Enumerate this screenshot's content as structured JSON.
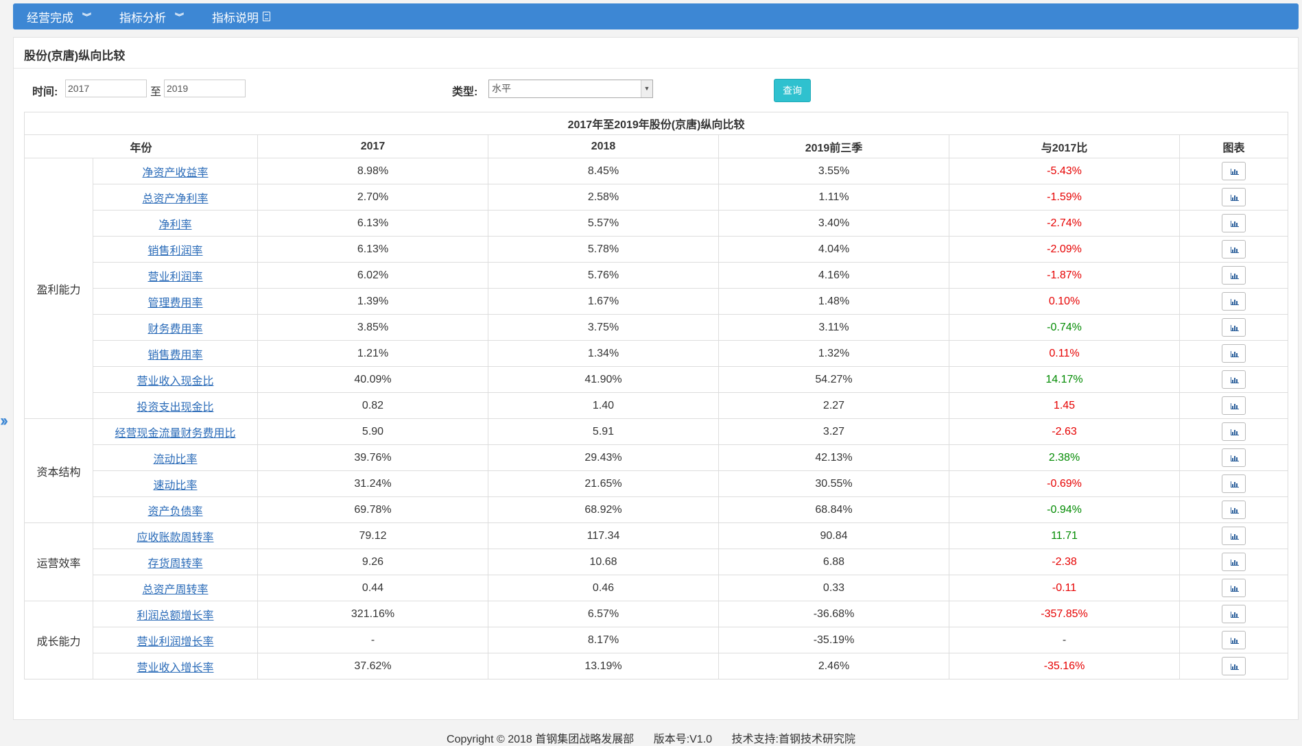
{
  "nav": [
    {
      "label": "经营完成",
      "icon": "double-chevron-down-icon"
    },
    {
      "label": "指标分析",
      "icon": "double-chevron-down-icon"
    },
    {
      "label": "指标说明",
      "icon": "document-icon"
    }
  ],
  "panel": {
    "title": "股份(京唐)纵向比较"
  },
  "filters": {
    "time_label": "时间:",
    "from_value": "2017",
    "to_text": "至",
    "to_value": "2019",
    "type_label": "类型:",
    "type_value": "水平",
    "query_label": "查询"
  },
  "table": {
    "caption": "2017年至2019年股份(京唐)纵向比较",
    "headers": [
      "年份",
      "2017",
      "2018",
      "2019前三季",
      "与2017比",
      "图表"
    ],
    "groups": [
      {
        "category": "盈利能力",
        "rows": [
          {
            "name": "净资产收益率",
            "v2017": "8.98%",
            "v2018": "8.45%",
            "v2019": "3.55%",
            "diff": "-5.43%",
            "trend": "neg"
          },
          {
            "name": "总资产净利率",
            "v2017": "2.70%",
            "v2018": "2.58%",
            "v2019": "1.11%",
            "diff": "-1.59%",
            "trend": "neg"
          },
          {
            "name": "净利率",
            "v2017": "6.13%",
            "v2018": "5.57%",
            "v2019": "3.40%",
            "diff": "-2.74%",
            "trend": "neg"
          },
          {
            "name": "销售利润率",
            "v2017": "6.13%",
            "v2018": "5.78%",
            "v2019": "4.04%",
            "diff": "-2.09%",
            "trend": "neg"
          },
          {
            "name": "营业利润率",
            "v2017": "6.02%",
            "v2018": "5.76%",
            "v2019": "4.16%",
            "diff": "-1.87%",
            "trend": "neg"
          },
          {
            "name": "管理费用率",
            "v2017": "1.39%",
            "v2018": "1.67%",
            "v2019": "1.48%",
            "diff": "0.10%",
            "trend": "neg"
          },
          {
            "name": "财务费用率",
            "v2017": "3.85%",
            "v2018": "3.75%",
            "v2019": "3.11%",
            "diff": "-0.74%",
            "trend": "pos"
          },
          {
            "name": "销售费用率",
            "v2017": "1.21%",
            "v2018": "1.34%",
            "v2019": "1.32%",
            "diff": "0.11%",
            "trend": "neg"
          },
          {
            "name": "营业收入现金比",
            "v2017": "40.09%",
            "v2018": "41.90%",
            "v2019": "54.27%",
            "diff": "14.17%",
            "trend": "pos"
          },
          {
            "name": "投资支出现金比",
            "v2017": "0.82",
            "v2018": "1.40",
            "v2019": "2.27",
            "diff": "1.45",
            "trend": "neg"
          }
        ]
      },
      {
        "category": "资本结构",
        "rows": [
          {
            "name": "经营现金流量财务费用比",
            "v2017": "5.90",
            "v2018": "5.91",
            "v2019": "3.27",
            "diff": "-2.63",
            "trend": "neg"
          },
          {
            "name": "流动比率",
            "v2017": "39.76%",
            "v2018": "29.43%",
            "v2019": "42.13%",
            "diff": "2.38%",
            "trend": "pos"
          },
          {
            "name": "速动比率",
            "v2017": "31.24%",
            "v2018": "21.65%",
            "v2019": "30.55%",
            "diff": "-0.69%",
            "trend": "neg"
          },
          {
            "name": "资产负债率",
            "v2017": "69.78%",
            "v2018": "68.92%",
            "v2019": "68.84%",
            "diff": "-0.94%",
            "trend": "pos"
          }
        ]
      },
      {
        "category": "运营效率",
        "rows": [
          {
            "name": "应收账款周转率",
            "v2017": "79.12",
            "v2018": "117.34",
            "v2019": "90.84",
            "diff": "11.71",
            "trend": "pos"
          },
          {
            "name": "存货周转率",
            "v2017": "9.26",
            "v2018": "10.68",
            "v2019": "6.88",
            "diff": "-2.38",
            "trend": "neg"
          },
          {
            "name": "总资产周转率",
            "v2017": "0.44",
            "v2018": "0.46",
            "v2019": "0.33",
            "diff": "-0.11",
            "trend": "neg"
          }
        ]
      },
      {
        "category": "成长能力",
        "rows": [
          {
            "name": "利润总额增长率",
            "v2017": "321.16%",
            "v2018": "6.57%",
            "v2019": "-36.68%",
            "diff": "-357.85%",
            "trend": "neg"
          },
          {
            "name": "营业利润增长率",
            "v2017": "-",
            "v2018": "8.17%",
            "v2019": "-35.19%",
            "diff": "-",
            "trend": "none"
          },
          {
            "name": "营业收入增长率",
            "v2017": "37.62%",
            "v2018": "13.19%",
            "v2019": "2.46%",
            "diff": "-35.16%",
            "trend": "neg"
          }
        ]
      }
    ]
  },
  "side_toggle_icon": "double-chevron-right-icon",
  "footer": {
    "copyright": "Copyright © 2018  首钢集团战略发展部",
    "version": "版本号:V1.0",
    "support": "技术支持:首钢技术研究院"
  },
  "colors": {
    "nav_bg": "#3d87d4",
    "query_btn": "#2fc1cf",
    "negative": "#e60000",
    "positive": "#008a00",
    "link": "#2a6bb8"
  }
}
